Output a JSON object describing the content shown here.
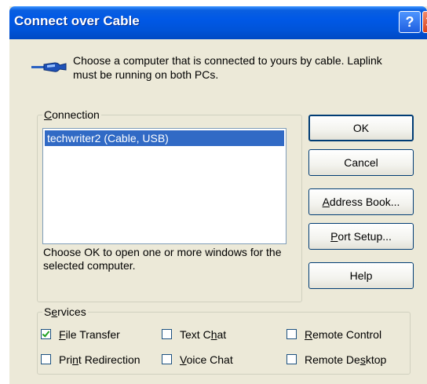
{
  "window": {
    "title": "Connect over Cable",
    "help_button": "?",
    "close_button": "✕"
  },
  "intro": {
    "icon": "cable-icon",
    "text": "Choose a computer that is connected to yours by cable.  Laplink must be running on both PCs."
  },
  "connection": {
    "legend_accel": "C",
    "legend_rest": "onnection",
    "items": [
      "techwriter2 (Cable, USB)"
    ],
    "selected_index": 0,
    "hint": "Choose OK to open one or more windows for the selected computer."
  },
  "buttons": {
    "ok": "OK",
    "cancel": "Cancel",
    "address_book_accel": "A",
    "address_book_rest": "ddress Book...",
    "port_setup_accel": "P",
    "port_setup_rest": "ort Setup...",
    "help": "Help"
  },
  "services": {
    "legend_pre": "S",
    "legend_accel": "e",
    "legend_post": "rvices",
    "file_transfer": {
      "accel": "F",
      "rest": "ile Transfer",
      "checked": true
    },
    "text_chat": {
      "pre": "Text C",
      "accel": "h",
      "post": "at",
      "checked": false
    },
    "remote_control": {
      "accel": "R",
      "rest": "emote Control",
      "checked": false
    },
    "print_redirection": {
      "pre": "Pri",
      "accel": "n",
      "post": "t Redirection",
      "checked": false
    },
    "voice_chat": {
      "accel": "V",
      "rest": "oice Chat",
      "checked": false
    },
    "remote_desktop": {
      "pre": "Remote De",
      "accel": "s",
      "post": "ktop",
      "checked": false
    }
  },
  "colors": {
    "title_bar": "#0054e3",
    "dialog_bg": "#ece9d8",
    "selection": "#316ac5"
  }
}
